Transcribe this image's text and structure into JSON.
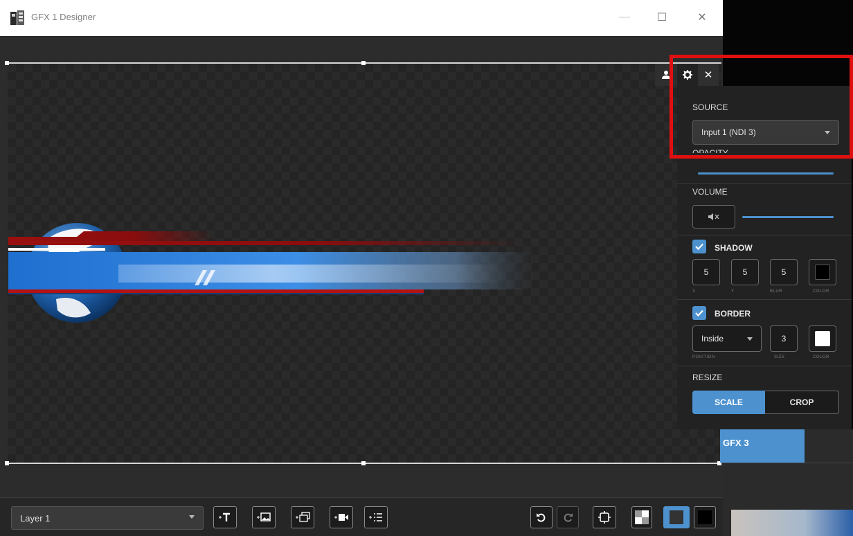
{
  "window": {
    "title": "GFX 1 Designer",
    "minimize_glyph": "—",
    "maximize_glyph": "☐",
    "close_glyph": "✕"
  },
  "toolbar": {
    "layer_select_value": "Layer 1",
    "add_buttons": [
      "add-text-icon",
      "add-image-icon",
      "add-slideshow-icon",
      "add-video-icon",
      "add-list-icon"
    ],
    "undo_icon": "undo-icon",
    "redo_icon": "redo-icon",
    "fit_icon": "fit-canvas-icon",
    "background_options": [
      "transparent",
      "dark",
      "black"
    ],
    "background_selected": "dark"
  },
  "popup": {
    "tabs": [
      "user-icon",
      "gear-icon",
      "close-icon"
    ],
    "close_glyph": "✕",
    "source": {
      "label": "SOURCE",
      "value": "Input 1 (NDI 3)"
    },
    "opacity": {
      "label": "OPACITY",
      "value_percent": 100
    },
    "volume": {
      "label": "VOLUME",
      "muted": true,
      "value_percent": 100
    },
    "shadow": {
      "label": "SHADOW",
      "enabled": true,
      "x": "5",
      "x_label": "X",
      "y": "5",
      "y_label": "Y",
      "blur": "5",
      "blur_label": "BLUR",
      "color": "#000000",
      "color_label": "COLOR"
    },
    "border": {
      "label": "BORDER",
      "enabled": true,
      "position": "Inside",
      "position_label": "POSITION",
      "size": "3",
      "size_label": "SIZE",
      "color": "#ffffff",
      "color_label": "COLOR"
    },
    "resize": {
      "label": "RESIZE",
      "options": [
        "SCALE",
        "CROP"
      ],
      "selected": "SCALE"
    }
  },
  "background_app": {
    "tile_label": "GFX 3"
  },
  "colors": {
    "accent": "#4d92cf",
    "highlight": "#e01010",
    "panel": "#222222"
  }
}
